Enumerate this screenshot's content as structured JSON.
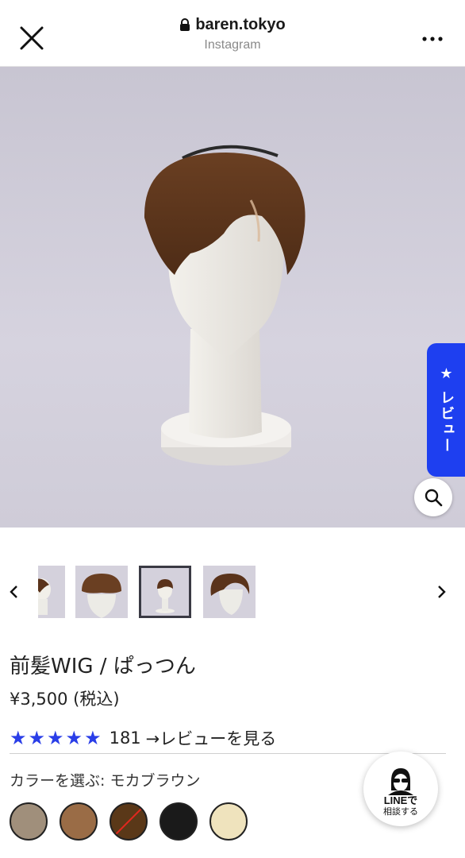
{
  "browser": {
    "url": "baren.tokyo",
    "source": "Instagram"
  },
  "hero": {
    "review_tab_label": "★ レビュー"
  },
  "product": {
    "title": "前髪WIG / ぱっつん",
    "price": "¥3,500 (税込)",
    "rating_count": "181",
    "review_link": "→レビューを見る",
    "rating_stars": 5
  },
  "colors": {
    "label": "カラーを選ぶ: モカブラウン",
    "swatches": [
      "#a08f7b",
      "#9a6c46",
      "#5a3818",
      "#1a1a1a",
      "#efe3bd"
    ]
  },
  "chat": {
    "line_label": "LINEで",
    "line_sub": "相談する"
  },
  "theme": {
    "accent": "#1e3ff0",
    "star_color": "#2a3ee8"
  }
}
